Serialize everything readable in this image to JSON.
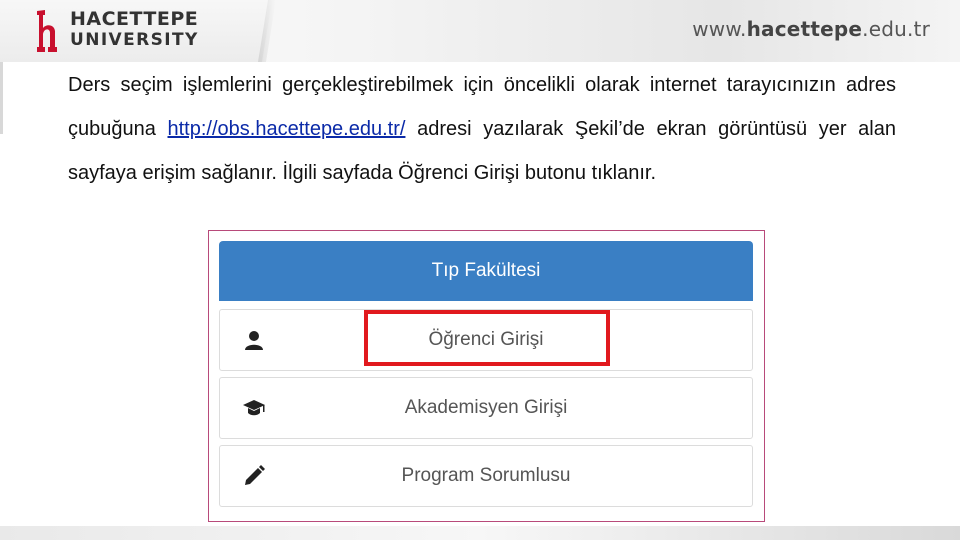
{
  "header": {
    "logo_line1": "HACETTEPE",
    "logo_line2": "UNIVERSITY",
    "logo_icon": "hacettepe-emblem-icon",
    "url_prefix": "www.",
    "url_bold": "hacettepe",
    "url_suffix": ".edu.tr",
    "accent": "#c8102e"
  },
  "paragraph": {
    "before_link": "Ders seçim işlemlerini gerçekleştirebilmek için öncelikli olarak internet tarayıcınızın adres çubuğuna ",
    "link": "http://obs.hacettepe.edu.tr/",
    "after_link": " adresi yazılarak Şekil’de ekran görüntüsü yer alan sayfaya erişim sağlanır. İlgili sayfada Öğrenci Girişi butonu tıklanır."
  },
  "panel": {
    "title": "Tıp Fakültesi",
    "header_color": "#3a7fc4",
    "highlight_color": "#e1191e",
    "items": [
      {
        "label": "Öğrenci Girişi",
        "icon": "user-icon"
      },
      {
        "label": "Akademisyen Girişi",
        "icon": "graduation-cap-icon"
      },
      {
        "label": "Program Sorumlusu",
        "icon": "pencil-icon"
      }
    ]
  }
}
